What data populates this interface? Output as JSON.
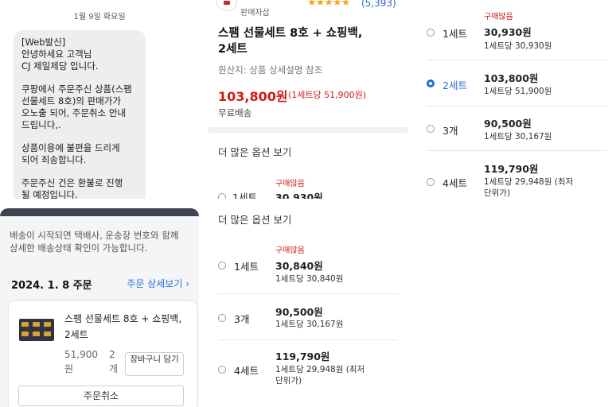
{
  "sms": {
    "date": "1월 9일 화요일",
    "paragraphs": [
      "[Web발신]\n안녕하세요 고객님\nCJ 제일제당 입니다.",
      "쿠팡에서 주문주신 상품(스팸\n선물세트 8호)의 판매가가\n오노출 되어, 주문취소 안내\n드립니다,.",
      "상품이용에 불편을 드리게\n되어 죄송합니다.",
      "주문주신 건은 환불로 진행\n될 예정입니다."
    ]
  },
  "order": {
    "notice": "배송이 시작되면 택배사, 운송장 번호와 함께\n상세한 배송상태 확인이 가능합니다.",
    "date": "2024. 1. 8 주문",
    "detail_link": "주문 상세보기 ›",
    "product_name": "스팸 선물세트 8호 + 쇼핑백,\n2세트",
    "price": "51,900원",
    "qty": "2개",
    "cart_button": "장바구니 담기",
    "cancel_button": "주문취소"
  },
  "product": {
    "seller_badge": "판매자삽",
    "stars": "★★★★★",
    "review_count": "(5,393)",
    "title": "스팸 선물세트 8호 + 쇼핑백,\n2세트",
    "origin": "원산지: 상품 상세설명 참조",
    "price": "103,800원",
    "unit_price": "(1세트당 51,900원)",
    "shipping": "무료배송",
    "more_options": "더 많은 옵션 보기",
    "partial_option": {
      "tag": "구매많음",
      "label": "1세트",
      "price": "30,930원"
    }
  },
  "options_bottom": {
    "more_options": "더 많은 옵션 보기",
    "items": [
      {
        "label": "1세트",
        "tag": "구매많음",
        "price": "30,840원",
        "per": "1세트당 30,840원",
        "selected": false
      },
      {
        "label": "3개",
        "tag": "",
        "price": "90,500원",
        "per": "1세트당 30,167원",
        "selected": false
      },
      {
        "label": "4세트",
        "tag": "",
        "price": "119,790원",
        "per": "1세트당 29,948원 (최저\n단위가)",
        "selected": false
      }
    ]
  },
  "options_right": {
    "items": [
      {
        "label": "1세트",
        "tag": "구매많음",
        "price": "30,930원",
        "per": "1세트당 30,930원",
        "selected": false
      },
      {
        "label": "2세트",
        "tag": "",
        "price": "103,800원",
        "per": "1세트당 51,900원",
        "selected": true
      },
      {
        "label": "3개",
        "tag": "",
        "price": "90,500원",
        "per": "1세트당 30,167원",
        "selected": false
      },
      {
        "label": "4세트",
        "tag": "",
        "price": "119,790원",
        "per": "1세트당 29,948원 (최저\n단위가)",
        "selected": false
      }
    ]
  },
  "colors": {
    "accent": "#2b6cd4",
    "sale_red": "#ce1a1a",
    "star": "#f5a623"
  }
}
